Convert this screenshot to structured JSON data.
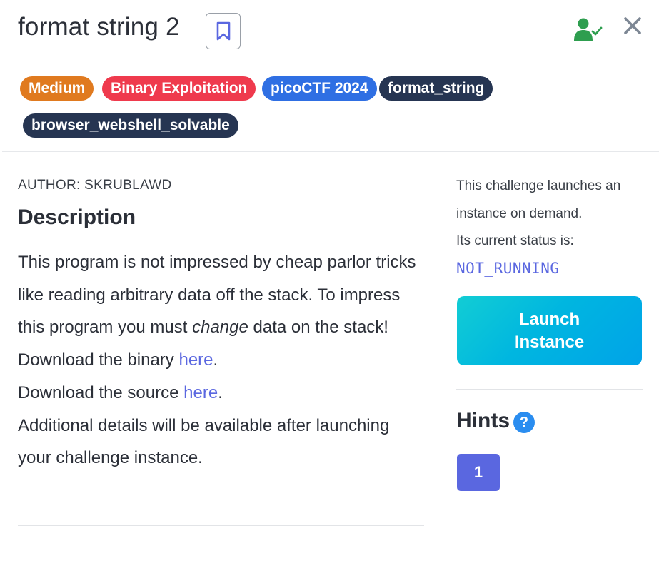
{
  "header": {
    "title": "format string 2",
    "bookmark_icon": "bookmark-icon",
    "user_status_icon": "user-check-icon",
    "close_icon": "close-icon",
    "colors": {
      "user_check": "#2e9e4f",
      "close": "#7d8794",
      "bookmark": "#5a67e0"
    }
  },
  "tags": [
    {
      "label": "Medium",
      "color": "#e07a1f"
    },
    {
      "label": "Binary Exploitation",
      "color": "#ef3a4d"
    },
    {
      "label": "picoCTF 2024",
      "color": "#2f6fe3"
    },
    {
      "label": "format_string",
      "color": "#263552"
    },
    {
      "label": "browser_webshell_solvable",
      "color": "#263552"
    }
  ],
  "main": {
    "author": "AUTHOR: SKRUBLAWD",
    "description_heading": "Description",
    "paragraph_1_prefix": "This program is not impressed by cheap parlor tricks like reading arbitrary data off the stack. To impress this program you must ",
    "paragraph_1_emphasis": "change",
    "paragraph_1_suffix": " data on the stack!",
    "binary_prefix": "Download the binary ",
    "binary_link": "here",
    "binary_suffix": ".",
    "source_prefix": "Download the source ",
    "source_link": "here",
    "source_suffix": ".",
    "additional": "Additional details will be available after launching your challenge instance."
  },
  "sidebar": {
    "info_line_1": "This challenge launches an instance on demand.",
    "info_line_2": "Its current status is:",
    "status": "NOT_RUNNING",
    "launch_line_1": "Launch",
    "launch_line_2": "Instance",
    "hints_heading": "Hints",
    "hints_help": "?",
    "hint_buttons": [
      "1"
    ]
  }
}
